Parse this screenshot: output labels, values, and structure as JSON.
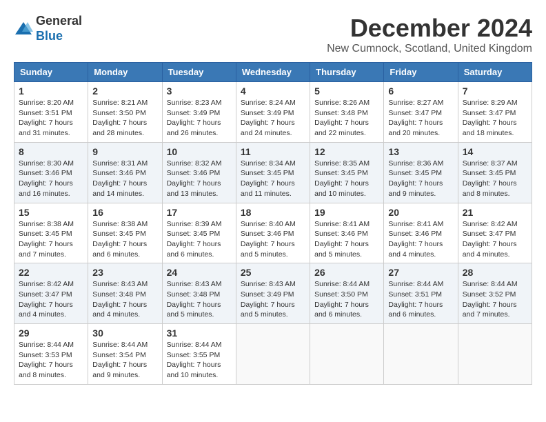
{
  "header": {
    "logo_line1": "General",
    "logo_line2": "Blue",
    "month_title": "December 2024",
    "location": "New Cumnock, Scotland, United Kingdom"
  },
  "days_of_week": [
    "Sunday",
    "Monday",
    "Tuesday",
    "Wednesday",
    "Thursday",
    "Friday",
    "Saturday"
  ],
  "weeks": [
    [
      {
        "day": "1",
        "sunrise": "Sunrise: 8:20 AM",
        "sunset": "Sunset: 3:51 PM",
        "daylight": "Daylight: 7 hours and 31 minutes."
      },
      {
        "day": "2",
        "sunrise": "Sunrise: 8:21 AM",
        "sunset": "Sunset: 3:50 PM",
        "daylight": "Daylight: 7 hours and 28 minutes."
      },
      {
        "day": "3",
        "sunrise": "Sunrise: 8:23 AM",
        "sunset": "Sunset: 3:49 PM",
        "daylight": "Daylight: 7 hours and 26 minutes."
      },
      {
        "day": "4",
        "sunrise": "Sunrise: 8:24 AM",
        "sunset": "Sunset: 3:49 PM",
        "daylight": "Daylight: 7 hours and 24 minutes."
      },
      {
        "day": "5",
        "sunrise": "Sunrise: 8:26 AM",
        "sunset": "Sunset: 3:48 PM",
        "daylight": "Daylight: 7 hours and 22 minutes."
      },
      {
        "day": "6",
        "sunrise": "Sunrise: 8:27 AM",
        "sunset": "Sunset: 3:47 PM",
        "daylight": "Daylight: 7 hours and 20 minutes."
      },
      {
        "day": "7",
        "sunrise": "Sunrise: 8:29 AM",
        "sunset": "Sunset: 3:47 PM",
        "daylight": "Daylight: 7 hours and 18 minutes."
      }
    ],
    [
      {
        "day": "8",
        "sunrise": "Sunrise: 8:30 AM",
        "sunset": "Sunset: 3:46 PM",
        "daylight": "Daylight: 7 hours and 16 minutes."
      },
      {
        "day": "9",
        "sunrise": "Sunrise: 8:31 AM",
        "sunset": "Sunset: 3:46 PM",
        "daylight": "Daylight: 7 hours and 14 minutes."
      },
      {
        "day": "10",
        "sunrise": "Sunrise: 8:32 AM",
        "sunset": "Sunset: 3:46 PM",
        "daylight": "Daylight: 7 hours and 13 minutes."
      },
      {
        "day": "11",
        "sunrise": "Sunrise: 8:34 AM",
        "sunset": "Sunset: 3:45 PM",
        "daylight": "Daylight: 7 hours and 11 minutes."
      },
      {
        "day": "12",
        "sunrise": "Sunrise: 8:35 AM",
        "sunset": "Sunset: 3:45 PM",
        "daylight": "Daylight: 7 hours and 10 minutes."
      },
      {
        "day": "13",
        "sunrise": "Sunrise: 8:36 AM",
        "sunset": "Sunset: 3:45 PM",
        "daylight": "Daylight: 7 hours and 9 minutes."
      },
      {
        "day": "14",
        "sunrise": "Sunrise: 8:37 AM",
        "sunset": "Sunset: 3:45 PM",
        "daylight": "Daylight: 7 hours and 8 minutes."
      }
    ],
    [
      {
        "day": "15",
        "sunrise": "Sunrise: 8:38 AM",
        "sunset": "Sunset: 3:45 PM",
        "daylight": "Daylight: 7 hours and 7 minutes."
      },
      {
        "day": "16",
        "sunrise": "Sunrise: 8:38 AM",
        "sunset": "Sunset: 3:45 PM",
        "daylight": "Daylight: 7 hours and 6 minutes."
      },
      {
        "day": "17",
        "sunrise": "Sunrise: 8:39 AM",
        "sunset": "Sunset: 3:45 PM",
        "daylight": "Daylight: 7 hours and 6 minutes."
      },
      {
        "day": "18",
        "sunrise": "Sunrise: 8:40 AM",
        "sunset": "Sunset: 3:46 PM",
        "daylight": "Daylight: 7 hours and 5 minutes."
      },
      {
        "day": "19",
        "sunrise": "Sunrise: 8:41 AM",
        "sunset": "Sunset: 3:46 PM",
        "daylight": "Daylight: 7 hours and 5 minutes."
      },
      {
        "day": "20",
        "sunrise": "Sunrise: 8:41 AM",
        "sunset": "Sunset: 3:46 PM",
        "daylight": "Daylight: 7 hours and 4 minutes."
      },
      {
        "day": "21",
        "sunrise": "Sunrise: 8:42 AM",
        "sunset": "Sunset: 3:47 PM",
        "daylight": "Daylight: 7 hours and 4 minutes."
      }
    ],
    [
      {
        "day": "22",
        "sunrise": "Sunrise: 8:42 AM",
        "sunset": "Sunset: 3:47 PM",
        "daylight": "Daylight: 7 hours and 4 minutes."
      },
      {
        "day": "23",
        "sunrise": "Sunrise: 8:43 AM",
        "sunset": "Sunset: 3:48 PM",
        "daylight": "Daylight: 7 hours and 4 minutes."
      },
      {
        "day": "24",
        "sunrise": "Sunrise: 8:43 AM",
        "sunset": "Sunset: 3:48 PM",
        "daylight": "Daylight: 7 hours and 5 minutes."
      },
      {
        "day": "25",
        "sunrise": "Sunrise: 8:43 AM",
        "sunset": "Sunset: 3:49 PM",
        "daylight": "Daylight: 7 hours and 5 minutes."
      },
      {
        "day": "26",
        "sunrise": "Sunrise: 8:44 AM",
        "sunset": "Sunset: 3:50 PM",
        "daylight": "Daylight: 7 hours and 6 minutes."
      },
      {
        "day": "27",
        "sunrise": "Sunrise: 8:44 AM",
        "sunset": "Sunset: 3:51 PM",
        "daylight": "Daylight: 7 hours and 6 minutes."
      },
      {
        "day": "28",
        "sunrise": "Sunrise: 8:44 AM",
        "sunset": "Sunset: 3:52 PM",
        "daylight": "Daylight: 7 hours and 7 minutes."
      }
    ],
    [
      {
        "day": "29",
        "sunrise": "Sunrise: 8:44 AM",
        "sunset": "Sunset: 3:53 PM",
        "daylight": "Daylight: 7 hours and 8 minutes."
      },
      {
        "day": "30",
        "sunrise": "Sunrise: 8:44 AM",
        "sunset": "Sunset: 3:54 PM",
        "daylight": "Daylight: 7 hours and 9 minutes."
      },
      {
        "day": "31",
        "sunrise": "Sunrise: 8:44 AM",
        "sunset": "Sunset: 3:55 PM",
        "daylight": "Daylight: 7 hours and 10 minutes."
      },
      null,
      null,
      null,
      null
    ]
  ]
}
